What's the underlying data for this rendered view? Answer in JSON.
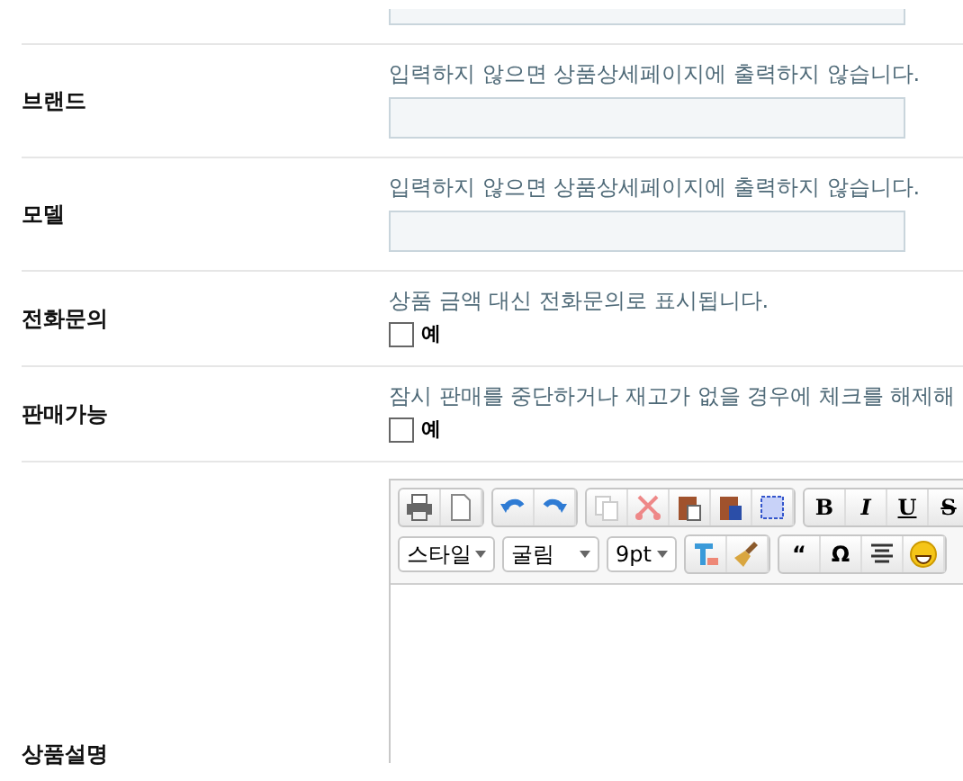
{
  "fields": [
    {
      "kind": "text",
      "label": "브랜드",
      "hint": "입력하지 않으면 상품상세페이지에 출력하지 않습니다."
    },
    {
      "kind": "text",
      "label": "모델",
      "hint": "입력하지 않으면 상품상세페이지에 출력하지 않습니다."
    },
    {
      "kind": "checkbox",
      "label": "전화문의",
      "hint": "상품 금액 대신 전화문의로 표시됩니다.",
      "option": "예",
      "checked": false
    },
    {
      "kind": "checkbox",
      "label": "판매가능",
      "hint": "잠시 판매를 중단하거나 재고가 없을 경우에 체크를 해제해",
      "option": "예",
      "checked": false
    }
  ],
  "editor": {
    "label": "상품설명",
    "format_buttons": [
      "B",
      "I",
      "U",
      "S"
    ],
    "dropdowns": [
      {
        "value": "스타일"
      },
      {
        "value": "굴림"
      },
      {
        "value": "9pt"
      }
    ],
    "symbol_buttons": [
      "“",
      "Ω"
    ]
  }
}
